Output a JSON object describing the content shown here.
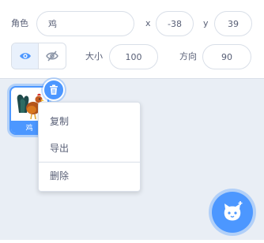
{
  "sprite_info": {
    "sprite_label": "角色",
    "sprite_name": "鸡",
    "x_label": "x",
    "x_value": "-38",
    "y_label": "y",
    "y_value": "39",
    "size_label": "大小",
    "size_value": "100",
    "direction_label": "方向",
    "direction_value": "90",
    "show_active": true
  },
  "sprite_list": {
    "tiles": [
      {
        "name": "鸡",
        "selected": true
      }
    ]
  },
  "context_menu": {
    "items": [
      {
        "label": "复制"
      },
      {
        "label": "导出"
      },
      {
        "label": "删除"
      }
    ]
  },
  "colors": {
    "accent": "#4c97ff",
    "text": "#575e75",
    "border": "#d9dfe8",
    "pane_bg": "#e9eef5"
  },
  "icons": {
    "show": "eye-icon",
    "hide": "eye-slash-icon",
    "delete": "trash-icon",
    "choose_sprite": "cat-plus-icon"
  }
}
